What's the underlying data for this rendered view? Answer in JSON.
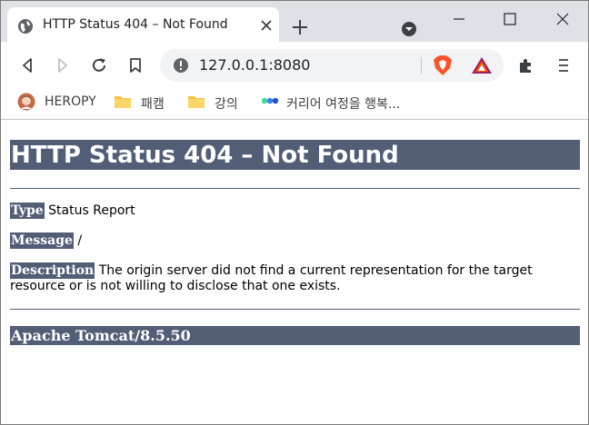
{
  "browser": {
    "tab": {
      "title": "HTTP Status 404 – Not Found"
    },
    "address_bar": {
      "url": "127.0.0.1:8080"
    },
    "bookmarks": [
      {
        "label": "HEROPY"
      },
      {
        "label": "패캠"
      },
      {
        "label": "강의"
      },
      {
        "label": "커리어 여정을 행복..."
      }
    ]
  },
  "page": {
    "heading": "HTTP Status 404 – Not Found",
    "type_label": "Type",
    "type_value": " Status Report",
    "message_label": "Message",
    "message_value": " /",
    "description_label": "Description",
    "description_value": " The origin server did not find a current representation for the target resource or is not willing to disclose that one exists.",
    "server_footer": "Apache Tomcat/8.5.50"
  },
  "colors": {
    "tomcat_header": "#525d76",
    "tab_strip": "#dee1e6"
  }
}
